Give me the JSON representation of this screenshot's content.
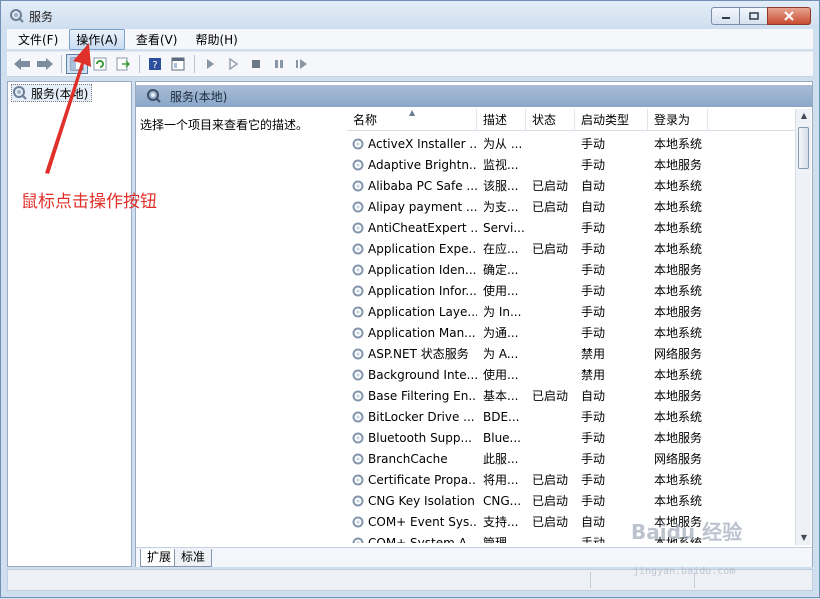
{
  "window": {
    "title": "服务"
  },
  "menu": [
    {
      "label": "文件(F)"
    },
    {
      "label": "操作(A)",
      "active": true
    },
    {
      "label": "查看(V)"
    },
    {
      "label": "帮助(H)"
    }
  ],
  "toolbar": {
    "icons": [
      "back-arrow-icon",
      "forward-arrow-icon",
      "console-tree-icon",
      "refresh-icon",
      "export-list-icon",
      "help-icon",
      "properties-icon",
      "start-icon",
      "start-alt-icon",
      "stop-icon",
      "pause-icon",
      "restart-icon"
    ]
  },
  "tree": {
    "item": "服务(本地)"
  },
  "pane": {
    "title": "服务(本地)",
    "description_prompt": "选择一个项目来查看它的描述。"
  },
  "columns": [
    "名称",
    "描述",
    "状态",
    "启动类型",
    "登录为"
  ],
  "services": [
    {
      "name": "ActiveX Installer ...",
      "desc": "为从 ...",
      "status": "",
      "startup": "手动",
      "logon": "本地系统"
    },
    {
      "name": "Adaptive Brightn...",
      "desc": "监视...",
      "status": "",
      "startup": "手动",
      "logon": "本地服务"
    },
    {
      "name": "Alibaba PC Safe ...",
      "desc": "该服...",
      "status": "已启动",
      "startup": "自动",
      "logon": "本地系统"
    },
    {
      "name": "Alipay payment ...",
      "desc": "为支...",
      "status": "已启动",
      "startup": "自动",
      "logon": "本地系统"
    },
    {
      "name": "AntiCheatExpert ...",
      "desc": "Servi...",
      "status": "",
      "startup": "手动",
      "logon": "本地系统"
    },
    {
      "name": "Application Expe...",
      "desc": "在应...",
      "status": "已启动",
      "startup": "手动",
      "logon": "本地系统"
    },
    {
      "name": "Application Iden...",
      "desc": "确定...",
      "status": "",
      "startup": "手动",
      "logon": "本地服务"
    },
    {
      "name": "Application Infor...",
      "desc": "使用...",
      "status": "",
      "startup": "手动",
      "logon": "本地系统"
    },
    {
      "name": "Application Laye...",
      "desc": "为 In...",
      "status": "",
      "startup": "手动",
      "logon": "本地服务"
    },
    {
      "name": "Application Man...",
      "desc": "为通...",
      "status": "",
      "startup": "手动",
      "logon": "本地系统"
    },
    {
      "name": "ASP.NET 状态服务",
      "desc": "为 A...",
      "status": "",
      "startup": "禁用",
      "logon": "网络服务"
    },
    {
      "name": "Background Inte...",
      "desc": "使用...",
      "status": "",
      "startup": "禁用",
      "logon": "本地系统"
    },
    {
      "name": "Base Filtering En...",
      "desc": "基本...",
      "status": "已启动",
      "startup": "自动",
      "logon": "本地服务"
    },
    {
      "name": "BitLocker Drive ...",
      "desc": "BDE...",
      "status": "",
      "startup": "手动",
      "logon": "本地系统"
    },
    {
      "name": "Bluetooth Supp...",
      "desc": "Blue...",
      "status": "",
      "startup": "手动",
      "logon": "本地服务"
    },
    {
      "name": "BranchCache",
      "desc": "此服...",
      "status": "",
      "startup": "手动",
      "logon": "网络服务"
    },
    {
      "name": "Certificate Propa...",
      "desc": "将用...",
      "status": "已启动",
      "startup": "手动",
      "logon": "本地系统"
    },
    {
      "name": "CNG Key Isolation",
      "desc": "CNG...",
      "status": "已启动",
      "startup": "手动",
      "logon": "本地系统"
    },
    {
      "name": "COM+ Event Sys...",
      "desc": "支持...",
      "status": "已启动",
      "startup": "自动",
      "logon": "本地服务"
    },
    {
      "name": "COM+ System A...",
      "desc": "管理...",
      "status": "",
      "startup": "手动",
      "logon": "本地系统"
    }
  ],
  "tabs": [
    "扩展",
    "标准"
  ],
  "annotation": {
    "text": "鼠标点击操作按钮",
    "color": "#e0302a"
  },
  "watermark": {
    "text": "Baidu 经验",
    "sub": "jingyan.baidu.com"
  }
}
